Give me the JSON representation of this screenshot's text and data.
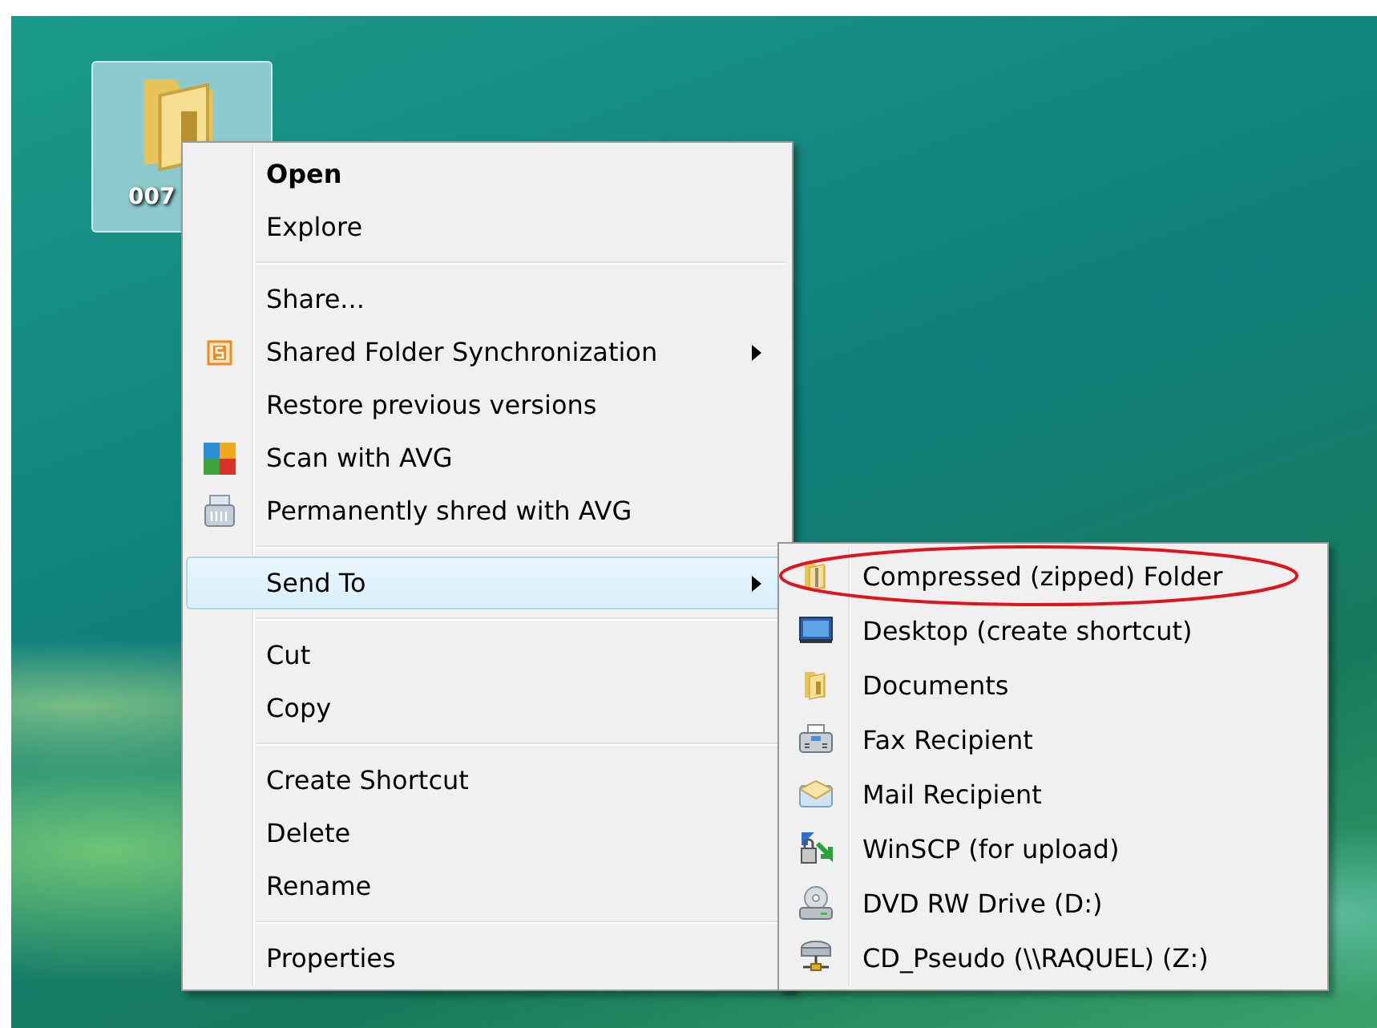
{
  "desktop": {
    "icons": [
      {
        "label": "007",
        "selected": true
      }
    ]
  },
  "context_menu": {
    "groups": [
      [
        {
          "label": "Open",
          "default": true,
          "has_submenu": false,
          "selected": false
        },
        {
          "label": "Explore",
          "default": false,
          "has_submenu": false,
          "selected": false
        }
      ],
      [
        {
          "label": "Share...",
          "default": false,
          "has_submenu": false,
          "selected": false
        },
        {
          "label": "Shared Folder Synchronization",
          "default": false,
          "has_submenu": true,
          "selected": false
        },
        {
          "label": "Restore previous versions",
          "default": false,
          "has_submenu": false,
          "selected": false
        },
        {
          "label": "Scan with AVG",
          "default": false,
          "has_submenu": false,
          "selected": false
        },
        {
          "label": "Permanently shred with AVG",
          "default": false,
          "has_submenu": false,
          "selected": false
        }
      ],
      [
        {
          "label": "Send To",
          "default": false,
          "has_submenu": true,
          "selected": true
        }
      ],
      [
        {
          "label": "Cut",
          "default": false,
          "has_submenu": false,
          "selected": false
        },
        {
          "label": "Copy",
          "default": false,
          "has_submenu": false,
          "selected": false
        }
      ],
      [
        {
          "label": "Create Shortcut",
          "default": false,
          "has_submenu": false,
          "selected": false
        },
        {
          "label": "Delete",
          "default": false,
          "has_submenu": false,
          "selected": false
        },
        {
          "label": "Rename",
          "default": false,
          "has_submenu": false,
          "selected": false
        }
      ],
      [
        {
          "label": "Properties",
          "default": false,
          "has_submenu": false,
          "selected": false
        }
      ]
    ]
  },
  "send_to_menu": {
    "items": [
      {
        "label": "Compressed (zipped) Folder",
        "circled": true
      },
      {
        "label": "Desktop (create shortcut)",
        "circled": false
      },
      {
        "label": "Documents",
        "circled": false
      },
      {
        "label": "Fax Recipient",
        "circled": false
      },
      {
        "label": "Mail Recipient",
        "circled": false
      },
      {
        "label": "WinSCP (for upload)",
        "circled": false
      },
      {
        "label": "DVD RW Drive (D:)",
        "circled": false
      },
      {
        "label": "CD_Pseudo (\\\\RAQUEL) (Z:)",
        "circled": false
      }
    ]
  }
}
